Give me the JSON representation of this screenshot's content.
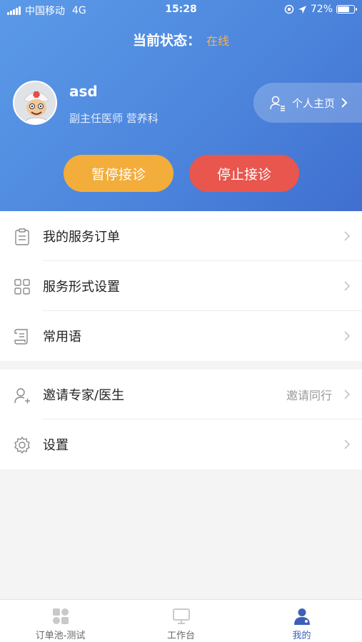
{
  "status_bar": {
    "carrier": "中国移动",
    "network": "4G",
    "time": "15:28",
    "battery": "72%",
    "battery_level": 0.72
  },
  "header": {
    "state_label": "当前状态：",
    "state_value": "在线"
  },
  "profile": {
    "name": "asd",
    "title": "副主任医师 营养科",
    "home_link": "个人主页"
  },
  "actions": {
    "pause": "暂停接诊",
    "stop": "停止接诊"
  },
  "menu1": [
    {
      "label": "我的服务订单",
      "icon": "clipboard-icon"
    },
    {
      "label": "服务形式设置",
      "icon": "grid-icon"
    },
    {
      "label": "常用语",
      "icon": "scroll-icon"
    }
  ],
  "menu2": [
    {
      "label": "邀请专家/医生",
      "icon": "add-user-icon",
      "extra": "邀请同行"
    },
    {
      "label": "设置",
      "icon": "gear-icon"
    }
  ],
  "tabs": [
    {
      "label": "订单池-测试",
      "icon": "apps-icon"
    },
    {
      "label": "工作台",
      "icon": "monitor-icon"
    },
    {
      "label": "我的",
      "icon": "user-icon"
    }
  ],
  "colors": {
    "accent": "#3e5fb8",
    "pause": "#f3ad3b",
    "stop": "#e8564d",
    "online": "#f5b34c"
  }
}
